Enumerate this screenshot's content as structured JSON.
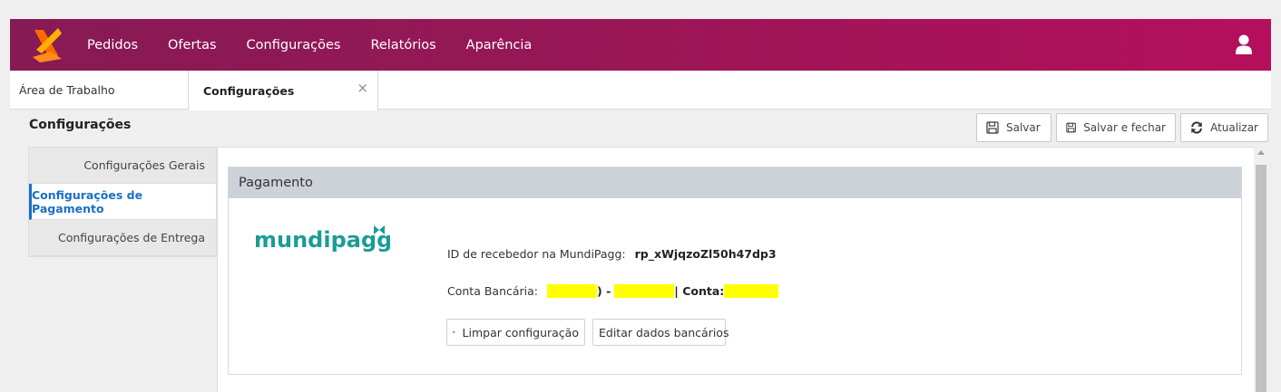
{
  "nav": {
    "items": [
      "Pedidos",
      "Ofertas",
      "Configurações",
      "Relatórios",
      "Aparência"
    ]
  },
  "tabs": {
    "home": "Área de Trabalho",
    "active": "Configurações",
    "close": "×"
  },
  "page": {
    "title": "Configurações"
  },
  "toolbar": {
    "save": "Salvar",
    "save_close": "Salvar e fechar",
    "refresh": "Atualizar"
  },
  "sidebar": {
    "items": [
      "Configurações Gerais",
      "Configurações de Pagamento",
      "Configurações de Entrega"
    ]
  },
  "panel": {
    "header": "Pagamento",
    "logo_text": "mundipagg",
    "receiver_label": "ID de recebedor na MundiPagg:",
    "receiver_value": "rp_xWjqzoZl50h47dp3",
    "bank_label": "Conta Bancária:",
    "bank_sep1": ") -",
    "bank_sep2": "| Conta:",
    "clear_button": "Limpar configuração",
    "edit_button": "Editar dados bancários"
  },
  "colors": {
    "accent": "#1a6fc4",
    "topbar_start": "#861a55",
    "topbar_end": "#b50f5d",
    "mundipagg": "#1c9c96",
    "redaction": "#ffff00"
  }
}
